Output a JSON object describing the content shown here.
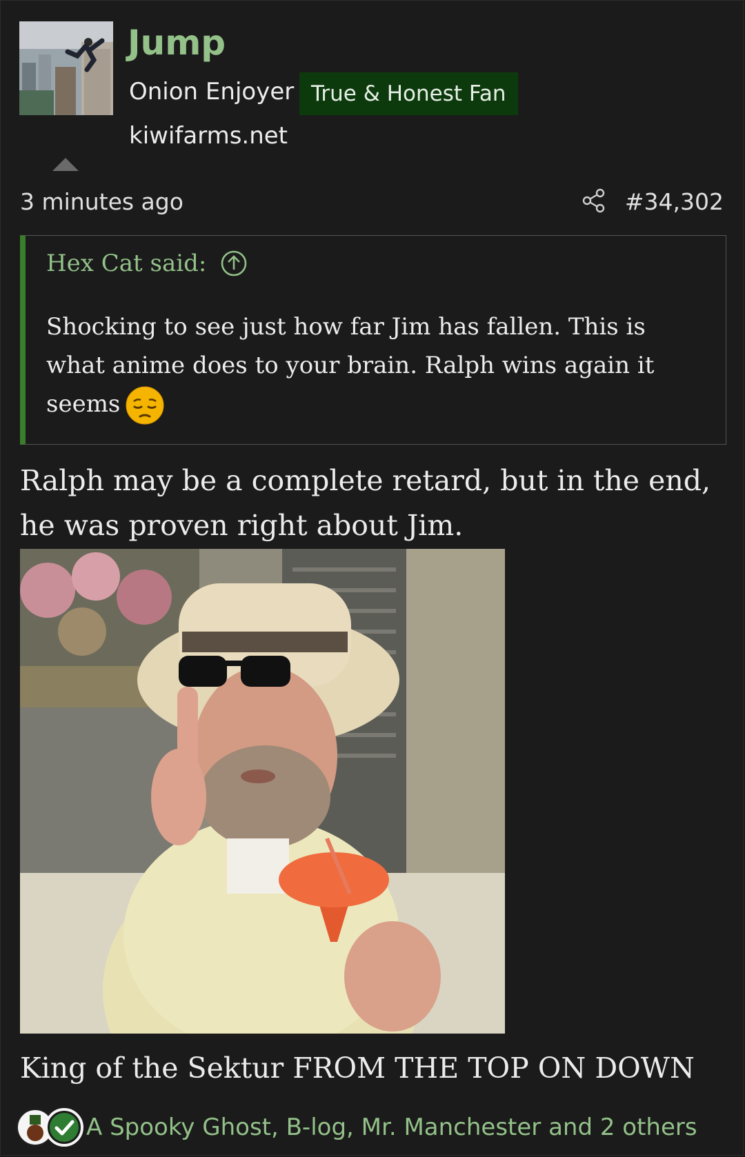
{
  "user": {
    "name": "Jump",
    "title": "Onion Enjoyer",
    "banner": "True & Honest Fan",
    "site": "kiwifarms.net"
  },
  "post": {
    "time": "3 minutes ago",
    "number": "#34,302",
    "quote": {
      "attribution": "Hex Cat said:",
      "text": "Shocking to see just how far Jim has fallen. This is what anime does to your brain. Ralph wins again it seems"
    },
    "body": "Ralph may be a complete retard, but in the end, he was proven right about Jim.",
    "signature": "King of the Sektur FROM THE TOP ON DOWN",
    "reactions": "A Spooky Ghost, B-log, Mr. Manchester and 2 others"
  },
  "icons": {
    "share": "share-icon",
    "jump_to_quote": "arrow-up-circle-icon",
    "emoji": "pensive-face-emoji",
    "reaction_1": "trophy-badge-icon",
    "reaction_2": "checkmark-icon"
  },
  "colors": {
    "background": "#1b1b1b",
    "accent_green": "#93c189",
    "banner_bg": "#0d3a0d",
    "quote_bar": "#3a7d2c"
  }
}
